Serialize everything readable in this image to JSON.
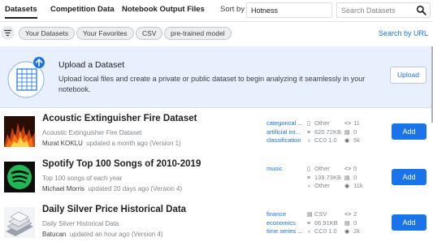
{
  "tabs": [
    {
      "label": "Datasets",
      "active": true
    },
    {
      "label": "Competition Data",
      "active": false
    },
    {
      "label": "Notebook Output Files",
      "active": false
    }
  ],
  "sort": {
    "label": "Sort by",
    "value": "Hotness"
  },
  "search": {
    "placeholder": "Search Datasets"
  },
  "filters": {
    "chips": [
      "Your Datasets",
      "Your Favorites",
      "CSV",
      "pre-trained model"
    ],
    "search_by_url": "Search by URL"
  },
  "upload": {
    "title": "Upload a Dataset",
    "description": "Upload local files and create a private or public dataset to begin analyzing it seamlessly in your notebook.",
    "button": "Upload"
  },
  "datasets": [
    {
      "title": "Acoustic Extinguisher Fire Dataset",
      "subtitle": "Acoustic Extinguisher Fire Dataset",
      "author": "Murat KOKLU",
      "updated": "updated a month ago (Version 1)",
      "tags": [
        "categorical ...",
        "artificial int...",
        "classification"
      ],
      "file_type": "Other",
      "size": "620.72KB",
      "license": "CC0 1.0",
      "code": "11",
      "discussions": "0",
      "views": "5k",
      "add_label": "Add"
    },
    {
      "title": "Spotify Top 100 Songs of 2010-2019",
      "subtitle": "Top 100 songs of each year",
      "author": "Michael Morris",
      "updated": "updated 20 days ago (Version 4)",
      "tags": [
        "music"
      ],
      "file_type": "Other",
      "size": "139.73KB",
      "license": "Other",
      "code": "0",
      "discussions": "0",
      "views": "11k",
      "add_label": "Add"
    },
    {
      "title": "Daily Silver Price Historical Data",
      "subtitle": "Daily Silver Historical Data",
      "author": "Batucan",
      "updated": "updated an hour ago (Version 4)",
      "tags": [
        "finance",
        "economics",
        "time series ..."
      ],
      "file_type": "CSV",
      "size": "66.91KB",
      "license": "CC0 1.0",
      "code": "2",
      "discussions": "0",
      "views": "2k",
      "add_label": "Add"
    }
  ],
  "colors": {
    "accent": "#1a73e8",
    "upload_bg": "#e8f0fe",
    "spotify_green": "#1db954"
  }
}
